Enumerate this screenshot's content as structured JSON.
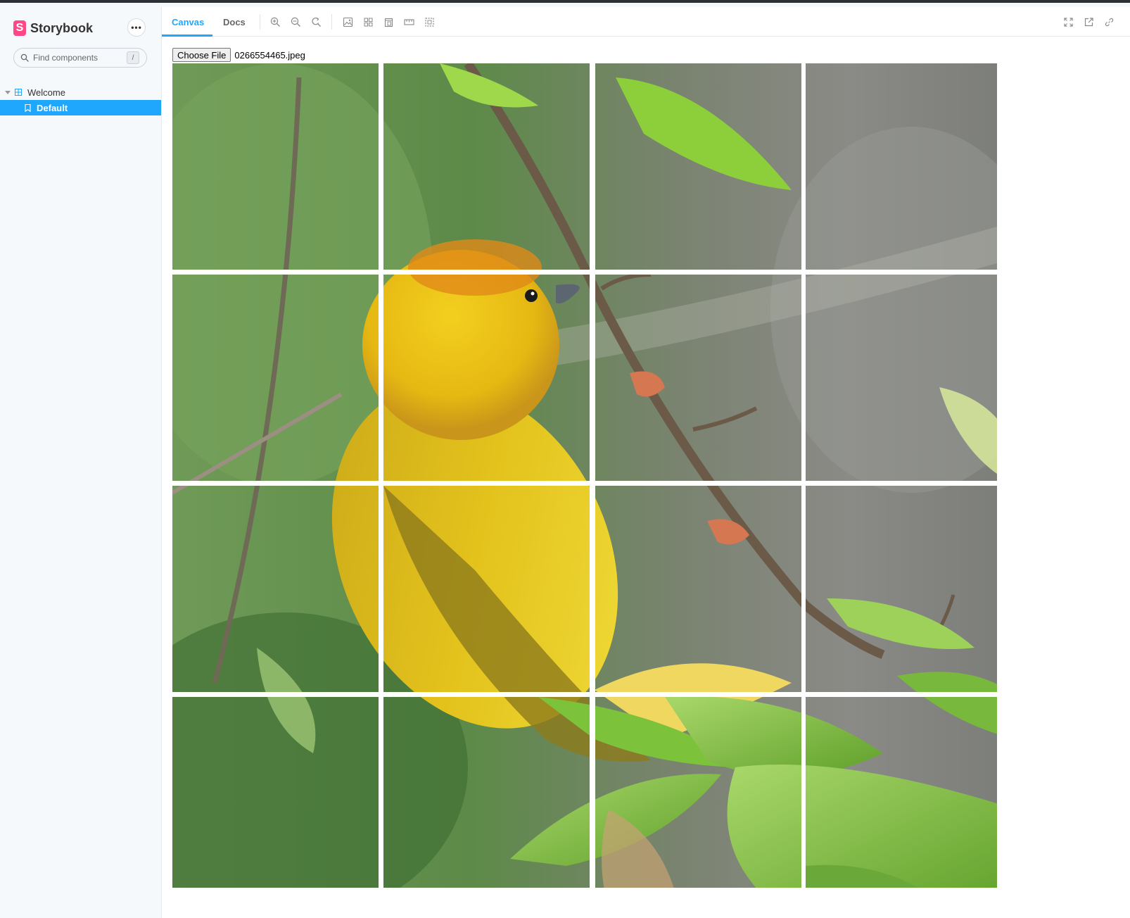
{
  "sidebar": {
    "brand": {
      "logo_letter": "S",
      "name": "Storybook"
    },
    "menu_label": "•••",
    "search": {
      "placeholder": "Find components",
      "shortcut": "/"
    },
    "tree": {
      "group_label": "Welcome",
      "items": [
        {
          "label": "Default",
          "selected": true
        }
      ]
    }
  },
  "toolbar": {
    "tabs": [
      {
        "label": "Canvas",
        "active": true
      },
      {
        "label": "Docs",
        "active": false
      }
    ],
    "left_icons": [
      "zoom-in-icon",
      "zoom-out-icon",
      "zoom-reset-icon",
      "background-image-icon",
      "grid-icon",
      "viewport-icon",
      "measure-icon",
      "outline-icon"
    ],
    "right_icons": [
      "fullscreen-icon",
      "open-new-tab-icon",
      "copy-link-icon"
    ]
  },
  "content": {
    "file_input": {
      "button_label": "Choose File",
      "file_name": "0266554465.jpeg"
    },
    "puzzle": {
      "rows": 4,
      "cols": 4,
      "subject": "yellow bird on branch photo"
    }
  },
  "colors": {
    "accent": "#1ea7fd",
    "brand": "#ff4785",
    "sidebar_bg": "#f6f9fc"
  }
}
